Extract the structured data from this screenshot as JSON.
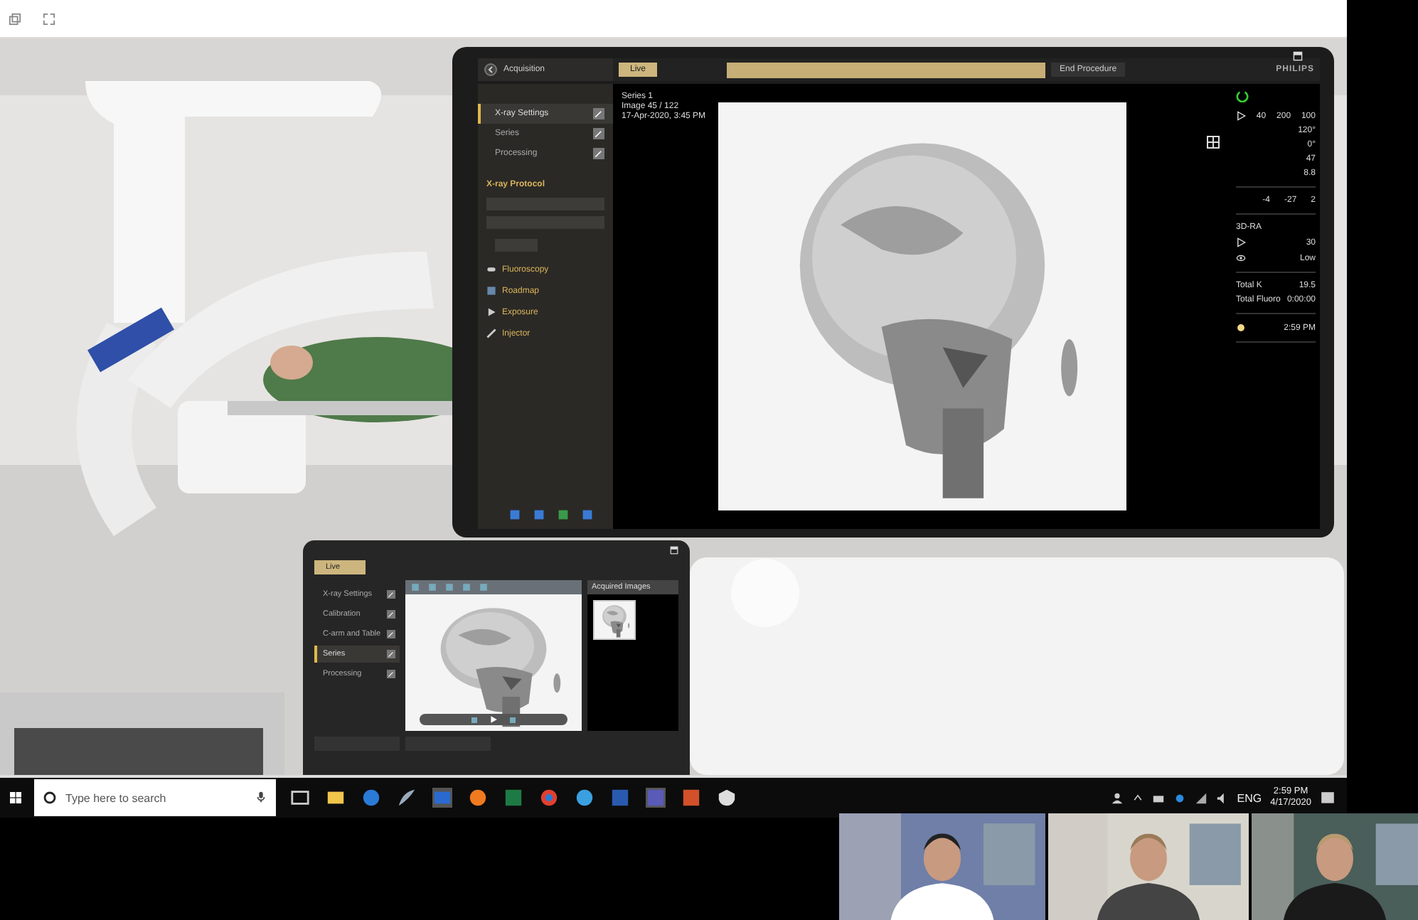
{
  "main_monitor": {
    "header": "Acquisition",
    "live_tab": {
      "label": "Live",
      "selected": true
    },
    "end_button": "End Procedure",
    "brand": "PHILIPS",
    "sidebar": [
      {
        "label": "X-ray Settings",
        "selected": true
      },
      {
        "label": "Series",
        "selected": false
      },
      {
        "label": "Processing",
        "selected": false
      }
    ],
    "protocol_heading": "X-ray Protocol",
    "sections": [
      "Fluoroscopy",
      "Roadmap",
      "Exposure",
      "Injector"
    ],
    "image_info": [
      "Series 1",
      "Image 45 / 122",
      "17-Apr-2020, 3:45 PM"
    ],
    "image": {
      "kind": "picture"
    },
    "readout_groups": [
      [
        {
          "kind": "play",
          "values": [
            "40",
            "200",
            "100"
          ]
        },
        {
          "kind": "value",
          "values": [
            "120°"
          ]
        },
        {
          "kind": "value",
          "values": [
            "0°"
          ]
        },
        {
          "kind": "value",
          "values": [
            "47"
          ]
        },
        {
          "kind": "value",
          "values": [
            "8.8"
          ]
        }
      ],
      [
        {
          "kind": "value",
          "values": [
            "-4",
            "-27",
            "2"
          ]
        }
      ],
      [
        {
          "kind": "heading",
          "values": [
            "3D-RA"
          ]
        },
        {
          "kind": "play",
          "values": [
            "30"
          ]
        },
        {
          "kind": "eye",
          "values": [
            "Low"
          ]
        }
      ],
      [
        {
          "kind": "label_value",
          "values": [
            "Total K",
            "19.5"
          ]
        },
        {
          "kind": "label_value",
          "values": [
            "Total Fluoro",
            "0:00:00"
          ]
        }
      ],
      [
        {
          "kind": "clock",
          "values": [
            "2:59 PM"
          ]
        }
      ]
    ]
  },
  "lower_monitor": {
    "live_tab": {
      "label": "Live",
      "selected": true
    },
    "sidebar": [
      {
        "label": "X-ray Settings",
        "selected": false
      },
      {
        "label": "Calibration",
        "selected": false
      },
      {
        "label": "C-arm and Table",
        "selected": false
      },
      {
        "label": "Series",
        "selected": true
      },
      {
        "label": "Processing",
        "selected": false
      }
    ],
    "image": {
      "kind": "picture"
    },
    "panel_title": "Acquired Images"
  },
  "taskbar": {
    "search": {
      "placeholder": "Type here to search"
    },
    "language": "ENG",
    "time": "2:59 PM",
    "date": "4/17/2020"
  },
  "video_tiles": [
    {
      "kind": "picture"
    },
    {
      "kind": "picture"
    },
    {
      "kind": "picture"
    }
  ]
}
